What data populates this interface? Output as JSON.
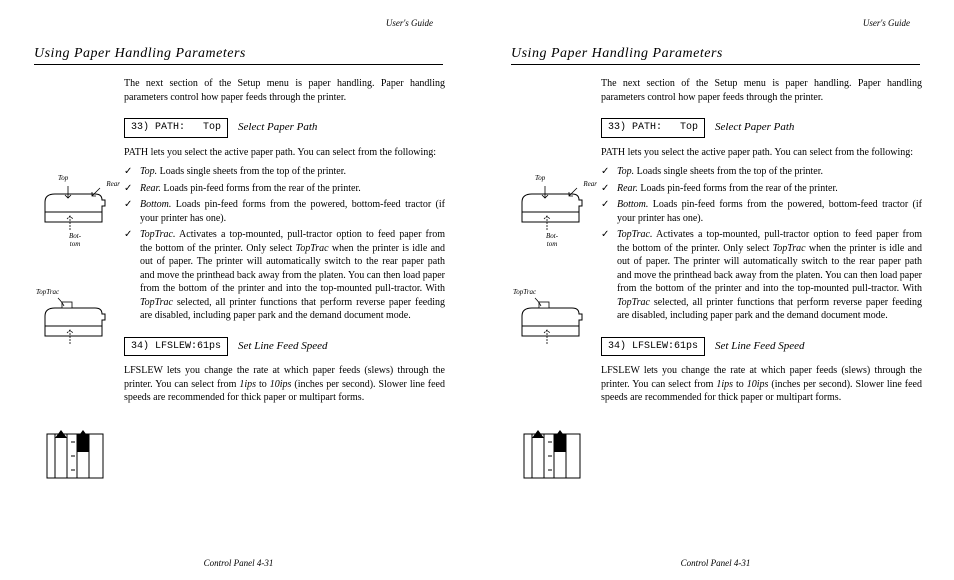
{
  "runningHead": "User's Guide",
  "sectionTitle": "Using  Paper  Handling  Parameters",
  "intro": "The next section of the Setup menu is paper handling.  Paper handling parameters control how paper feeds through the printer.",
  "param1": {
    "lcd": "33) PATH:   Top",
    "name": "Select Paper Path",
    "desc": "PATH lets you select the active paper path.  You can select from the following:",
    "opts": {
      "top": {
        "em": "Top.",
        "txt": "  Loads single sheets from the top of the printer."
      },
      "rear": {
        "em": "Rear.",
        "txt": "  Loads pin-feed forms from the rear of the printer."
      },
      "bottom": {
        "em": "Bottom.",
        "txt": "  Loads pin-feed forms from the powered, bottom-feed tractor (if your printer has one)."
      },
      "toptrac": {
        "em": "TopTrac.",
        "txt1": "  Activates a top-mounted, pull-tractor option to feed paper from the bottom of the printer.  Only select ",
        "em2": "TopTrac",
        "txt2": " when the printer is idle and out of paper.  The printer will automatically switch to the rear paper path and move the printhead back away from the platen.  You can then load paper from the bottom of the printer and into the top-mounted pull-tractor.  With ",
        "em3": "TopTrac",
        "txt3": " selected, all printer functions that perform reverse paper feeding are disabled, including paper park and the demand document mode."
      }
    }
  },
  "param2": {
    "lcd": "34) LFSLEW:61ps",
    "name": "Set Line Feed Speed",
    "desc1": "LFSLEW lets you change the rate at which paper feeds (slews) through the printer.  You can select from ",
    "em1": "1ips",
    "desc2": " to ",
    "em2": "10ips",
    "desc3": " (inches per second).  Slower line feed speeds are recommended for thick paper or multipart forms."
  },
  "figLabels": {
    "top": "Top",
    "rear": "Rear",
    "bottom": "Bot-\ntom",
    "toptrac": "TopTrac"
  },
  "footer": "Control Panel  4-31"
}
